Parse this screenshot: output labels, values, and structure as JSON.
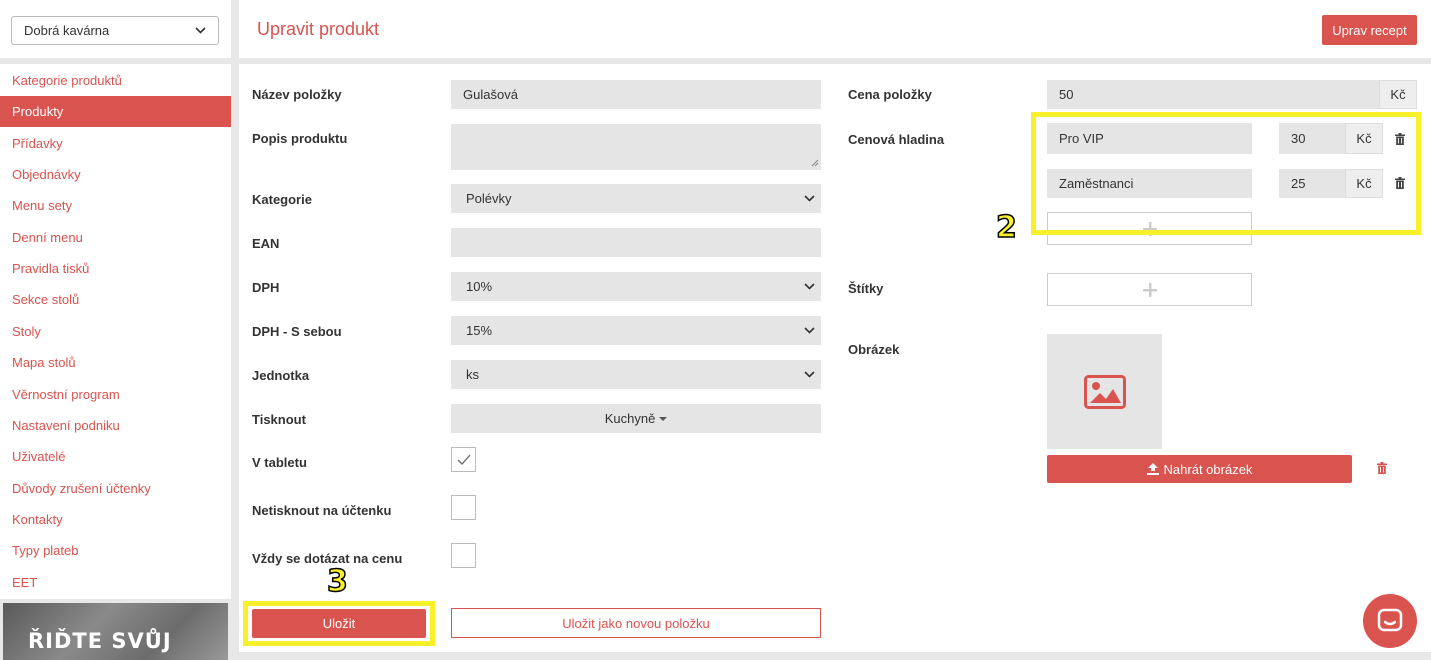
{
  "sidebar": {
    "venue": "Dobrá kavárna",
    "items": [
      {
        "label": "Kategorie produktů"
      },
      {
        "label": "Produkty"
      },
      {
        "label": "Přídavky"
      },
      {
        "label": "Objednávky"
      },
      {
        "label": "Menu sety"
      },
      {
        "label": "Denní menu"
      },
      {
        "label": "Pravidla tisků"
      },
      {
        "label": "Sekce stolů"
      },
      {
        "label": "Stoly"
      },
      {
        "label": "Mapa stolů"
      },
      {
        "label": "Věrnostní program"
      },
      {
        "label": "Nastavení podniku"
      },
      {
        "label": "Uživatelé"
      },
      {
        "label": "Důvody zrušení účtenky"
      },
      {
        "label": "Kontakty"
      },
      {
        "label": "Typy plateb"
      },
      {
        "label": "EET"
      }
    ],
    "active_index": 1,
    "banner_text": "ŘIĎTE SVŮJ"
  },
  "header": {
    "title": "Upravit produkt",
    "recipe_button": "Uprav recept"
  },
  "form": {
    "name": {
      "label": "Název položky",
      "value": "Gulašová"
    },
    "description": {
      "label": "Popis produktu",
      "value": ""
    },
    "category": {
      "label": "Kategorie",
      "value": "Polévky"
    },
    "ean": {
      "label": "EAN",
      "value": ""
    },
    "vat": {
      "label": "DPH",
      "value": "10%"
    },
    "vat_takeaway": {
      "label": "DPH - S sebou",
      "value": "15%"
    },
    "unit": {
      "label": "Jednotka",
      "value": "ks"
    },
    "print": {
      "label": "Tisknout",
      "value": "Kuchyně"
    },
    "in_tablet": {
      "label": "V tabletu",
      "checked": true
    },
    "no_print_receipt": {
      "label": "Netisknout na účtenku",
      "checked": false
    },
    "ask_price": {
      "label": "Vždy se dotázat na cenu",
      "checked": false
    },
    "save_button": "Uložit",
    "save_new_button": "Uložit jako novou položku"
  },
  "pricing": {
    "price": {
      "label": "Cena položky",
      "value": "50",
      "currency": "Kč"
    },
    "price_levels": {
      "label": "Cenová hladina",
      "items": [
        {
          "name": "Pro VIP",
          "value": "30",
          "currency": "Kč"
        },
        {
          "name": "Zaměstnanci",
          "value": "25",
          "currency": "Kč"
        }
      ]
    },
    "tags": {
      "label": "Štítky"
    },
    "image": {
      "label": "Obrázek",
      "upload_button": "Nahrát obrázek"
    }
  },
  "annotations": {
    "two": "2",
    "three": "3"
  },
  "colors": {
    "accent": "#d9534f",
    "highlight": "#f7f02a"
  }
}
